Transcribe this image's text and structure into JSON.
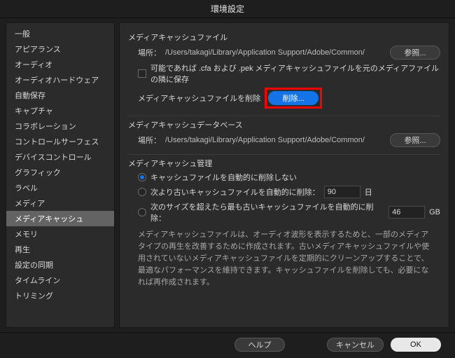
{
  "title": "環境設定",
  "sidebar": {
    "items": [
      {
        "label": "一般"
      },
      {
        "label": "アピアランス"
      },
      {
        "label": "オーディオ"
      },
      {
        "label": "オーディオハードウェア"
      },
      {
        "label": "自動保存"
      },
      {
        "label": "キャプチャ"
      },
      {
        "label": "コラボレーション"
      },
      {
        "label": "コントロールサーフェス"
      },
      {
        "label": "デバイスコントロール"
      },
      {
        "label": "グラフィック"
      },
      {
        "label": "ラベル"
      },
      {
        "label": "メディア"
      },
      {
        "label": "メディアキャッシュ",
        "selected": true
      },
      {
        "label": "メモリ"
      },
      {
        "label": "再生"
      },
      {
        "label": "設定の同期"
      },
      {
        "label": "タイムライン"
      },
      {
        "label": "トリミング"
      }
    ]
  },
  "sections": {
    "cache_files": {
      "title": "メディアキャッシュファイル",
      "location_label": "場所：",
      "location_path": "/Users/takagi/Library/Application Support/Adobe/Common/",
      "browse": "参照...",
      "save_next_label": "可能であれば .cfa および .pek メディアキャッシュファイルを元のメディアファイルの隣に保存",
      "delete_label": "メディアキャッシュファイルを削除",
      "delete_btn": "削除..."
    },
    "cache_db": {
      "title": "メディアキャッシュデータベース",
      "location_label": "場所：",
      "location_path": "/Users/takagi/Library/Application Support/Adobe/Common/",
      "browse": "参照..."
    },
    "cache_mgmt": {
      "title": "メディアキャッシュ管理",
      "opt_none": "キャッシュファイルを自動的に削除しない",
      "opt_days_pre": "次より古いキャッシュファイルを自動的に削除：",
      "opt_days_val": "90",
      "opt_days_suf": "日",
      "opt_size_pre": "次のサイズを超えたら最も古いキャッシュファイルを自動的に削除：",
      "opt_size_val": "46",
      "opt_size_suf": "GB",
      "help": "メディアキャッシュファイルは、オーディオ波形を表示するためと、一部のメディアタイプの再生を改善するために作成されます。古いメディアキャッシュファイルや使用されていないメディアキャッシュファイルを定期的にクリーンアップすることで、最適なパフォーマンスを維持できます。キャッシュファイルを削除しても、必要になれば再作成されます。"
    }
  },
  "footer": {
    "help": "ヘルプ",
    "cancel": "キャンセル",
    "ok": "OK"
  }
}
